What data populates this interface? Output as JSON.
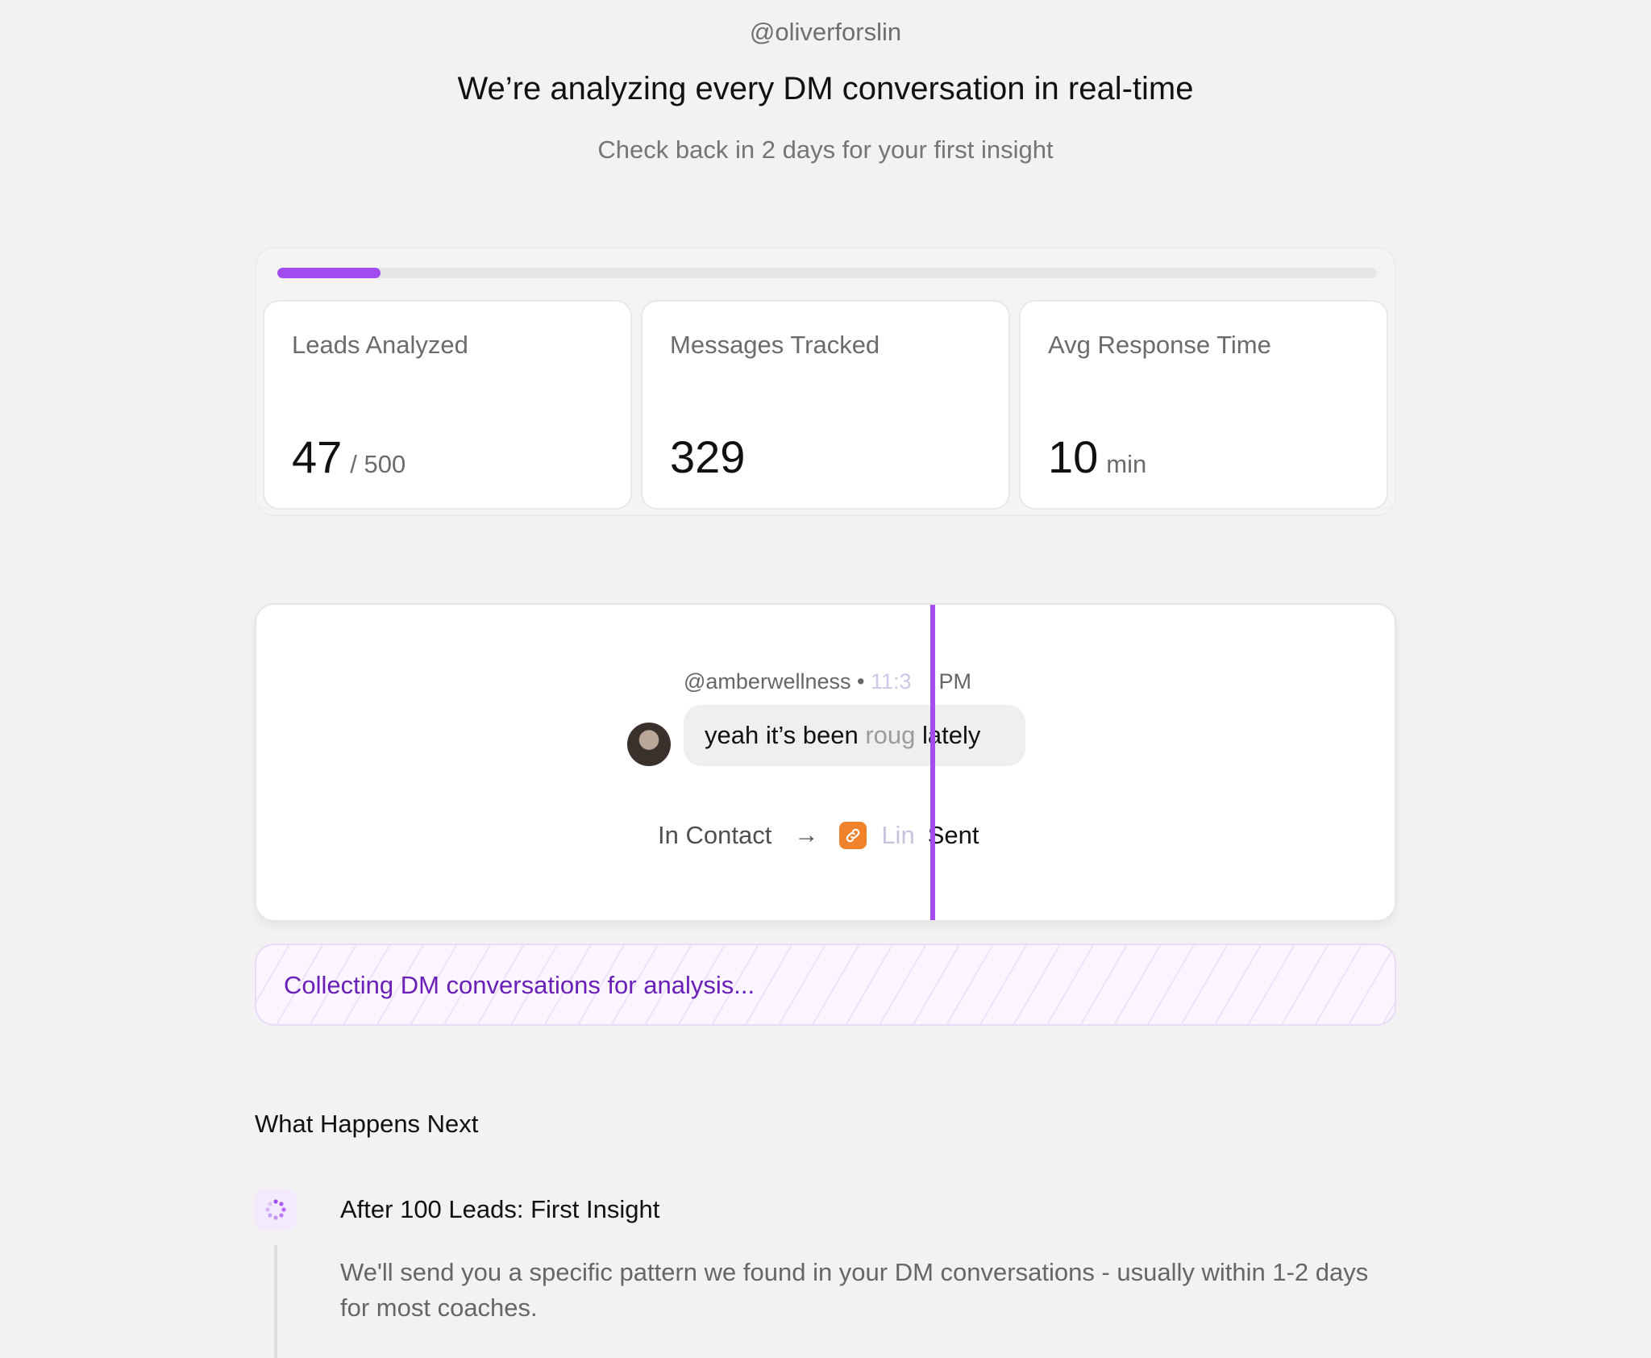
{
  "header": {
    "handle": "@oliverforslin",
    "title": "We’re analyzing every DM conversation in real-time",
    "subtitle": "Check back in 2 days for your first insight"
  },
  "progress": {
    "fraction": 0.094,
    "color": "#a24cf0"
  },
  "stats": [
    {
      "label": "Leads Analyzed",
      "value": "47",
      "suffix": "/ 500"
    },
    {
      "label": "Messages Tracked",
      "value": "329",
      "suffix": ""
    },
    {
      "label": "Avg Response Time",
      "value": "10",
      "suffix": "min"
    }
  ],
  "demo": {
    "username": "@amberwellness",
    "separator": "•",
    "time_visible_a": "11:3",
    "time_visible_b": "PM",
    "message_part_a": "yeah it’s been ",
    "message_fade": "roug",
    "message_part_b": " lately",
    "status_from": "In Contact",
    "arrow": "→",
    "status_to_fade": "Lin",
    "status_to_b": "Sent",
    "link_icon": "link-icon",
    "accent_color": "#a24cf0",
    "link_icon_color": "#f0822c"
  },
  "banner": {
    "text": "Collecting DM conversations for analysis..."
  },
  "next": {
    "heading": "What Happens Next",
    "steps": [
      {
        "icon": "spinner-icon",
        "title": "After 100 Leads: First Insight",
        "description": "We'll send you a specific pattern we found in your DM conversations - usually within 1-2 days for most coaches."
      }
    ]
  }
}
